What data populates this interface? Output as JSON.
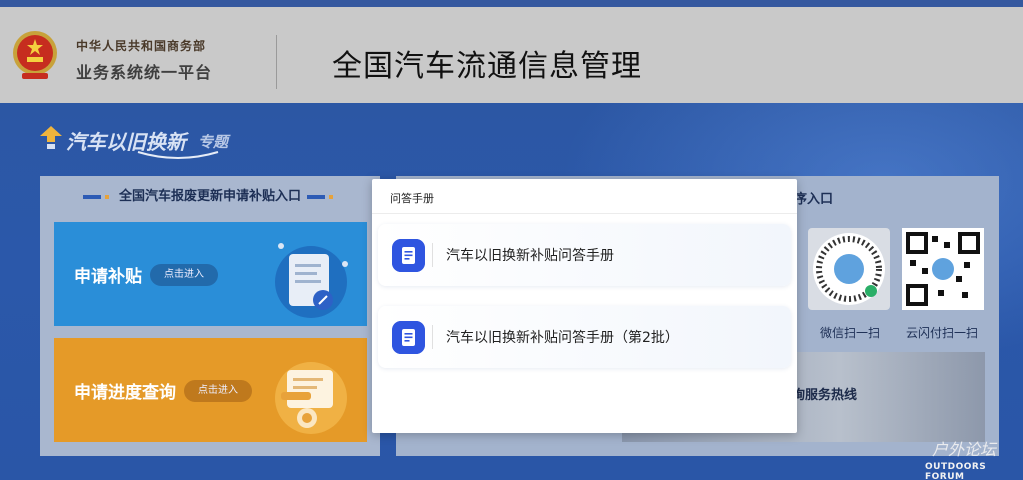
{
  "header": {
    "org_line1": "中华人民共和国商务部",
    "org_line2": "业务系统统一平台",
    "system_title": "全国汽车流通信息管理"
  },
  "topic": {
    "title": "汽车以旧换新",
    "subtitle": "专题"
  },
  "left_panel": {
    "heading": "全国汽车报废更新申请补贴入口",
    "cards": [
      {
        "title": "申请补贴",
        "button": "点击进入"
      },
      {
        "title": "申请进度查询",
        "button": "点击进入"
      }
    ]
  },
  "right_panel": {
    "heading_fragment": "序入口",
    "qr_wechat_label": "微信扫一扫",
    "qr_union_label": "云闪付扫一扫",
    "hotline_fragment": "询服务热线"
  },
  "modal": {
    "title": "问答手册",
    "items": [
      {
        "label": "汽车以旧换新补贴问答手册"
      },
      {
        "label": "汽车以旧换新补贴问答手册（第2批）"
      }
    ]
  },
  "watermark": {
    "line1": "户外论坛",
    "line2": "OUTDOORS FORUM"
  },
  "colors": {
    "header_bg": "#c9c9c9",
    "page_bg": "#2a56a7",
    "card_blue": "#2a8ed8",
    "card_orange": "#e59a28",
    "doc_icon": "#2f55e0"
  }
}
